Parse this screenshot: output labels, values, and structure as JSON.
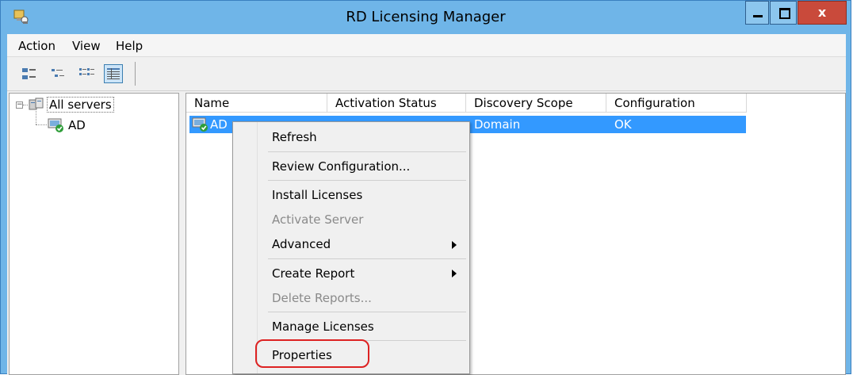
{
  "window": {
    "title": "RD Licensing Manager",
    "app_icon": "server-licensing-icon",
    "controls": {
      "minimize_icon": "minimize-icon",
      "maximize_icon": "maximize-icon",
      "close_glyph": "x"
    }
  },
  "menubar": {
    "items": [
      "Action",
      "View",
      "Help"
    ]
  },
  "toolbar": {
    "buttons": [
      "large-icons-view-icon",
      "small-icons-view-icon",
      "list-view-icon",
      "details-view-icon"
    ],
    "active": "details-view-icon"
  },
  "tree": {
    "expander_glyph": "−",
    "root": {
      "label": "All servers",
      "icon": "servers-folder-icon"
    },
    "children": [
      {
        "label": "AD",
        "icon": "license-server-ok-icon"
      }
    ]
  },
  "list": {
    "columns": [
      "Name",
      "Activation Status",
      "Discovery Scope",
      "Configuration"
    ],
    "rows": [
      {
        "name": "AD",
        "discovery_scope": "Domain",
        "configuration": "OK",
        "icon": "license-server-ok-icon"
      }
    ]
  },
  "context_menu": {
    "items": [
      {
        "label": "Refresh",
        "enabled": true
      },
      {
        "label": "Review Configuration...",
        "enabled": true
      },
      {
        "label": "Install Licenses",
        "enabled": true
      },
      {
        "label": "Activate Server",
        "enabled": false
      },
      {
        "label": "Advanced",
        "enabled": true,
        "submenu": true
      },
      {
        "label": "Create Report",
        "enabled": true,
        "submenu": true
      },
      {
        "label": "Delete Reports...",
        "enabled": false
      },
      {
        "label": "Manage Licenses",
        "enabled": true
      },
      {
        "label": "Properties",
        "enabled": true,
        "highlighted": true
      }
    ]
  },
  "colors": {
    "titlebar": "#6fb5e8",
    "selection": "#3399ff",
    "close": "#c94a3b",
    "annotation": "#dd2222"
  }
}
